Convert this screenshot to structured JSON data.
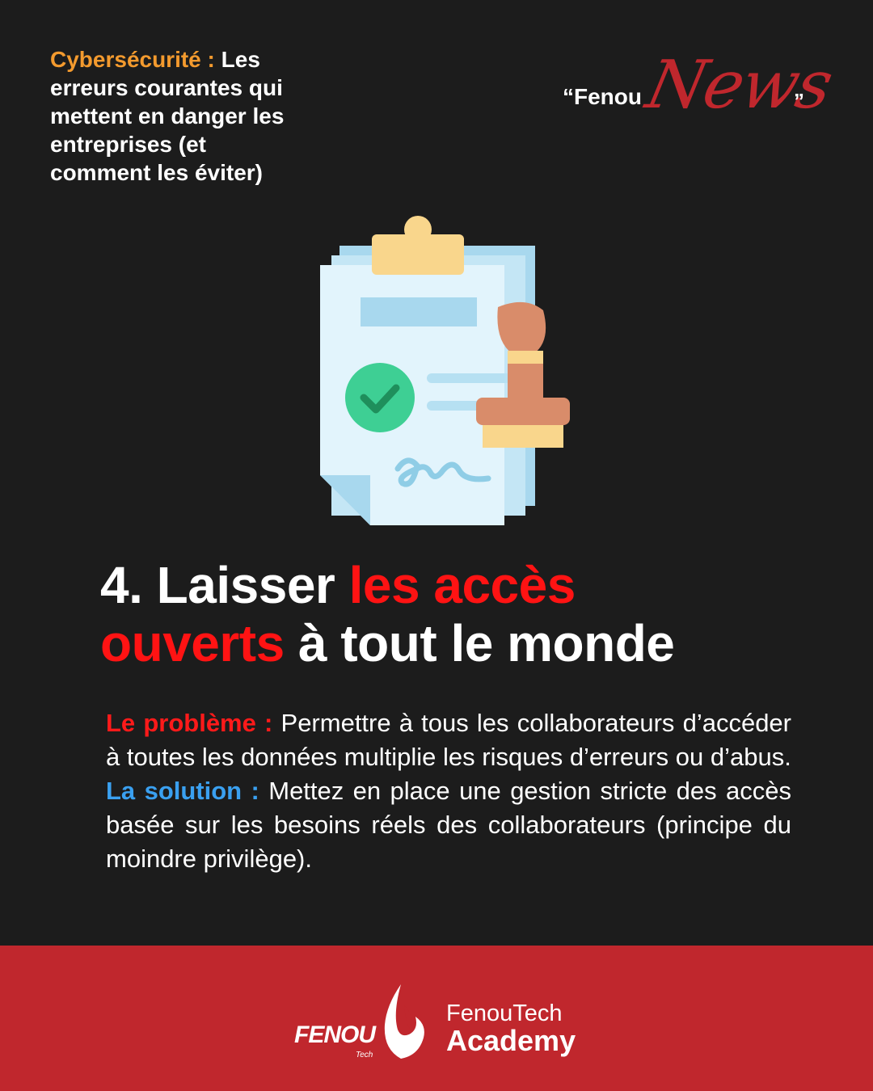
{
  "header": {
    "topic_label": "Cybersécurité :",
    "topic_text": " Les erreurs courantes qui mettent en danger les entreprises (et comment les éviter)"
  },
  "brand": {
    "open_quote_word": "“Fenou",
    "script_word": "News",
    "close_quote": "”"
  },
  "title": {
    "prefix": "4. Laisser ",
    "highlight_1": "les accès",
    "highlight_2": "ouverts",
    "suffix": " à tout le monde"
  },
  "body": {
    "problem_label": "Le problème :",
    "problem_text": " Permettre à tous les collaborateurs d’accéder à toutes les données multiplie les risques d’erreurs ou d’abus.",
    "solution_label": "La solution :",
    "solution_text": " Mettez en place une gestion stricte des accès basée sur les besoins réels des collaborateurs (principe du moindre privilège)."
  },
  "footer": {
    "logo_word": "FENOU",
    "logo_sub": "Tech",
    "name_line1": "FenouTech",
    "name_line2": "Academy"
  },
  "colors": {
    "background": "#1c1c1c",
    "accent_orange": "#f39a2e",
    "accent_red": "#ff1313",
    "accent_blue": "#3aa0f0",
    "footer_red": "#c0272d"
  },
  "icons": {
    "illustration": "clipboard-stamp-icon",
    "footer_logo": "fenoutech-logo"
  }
}
